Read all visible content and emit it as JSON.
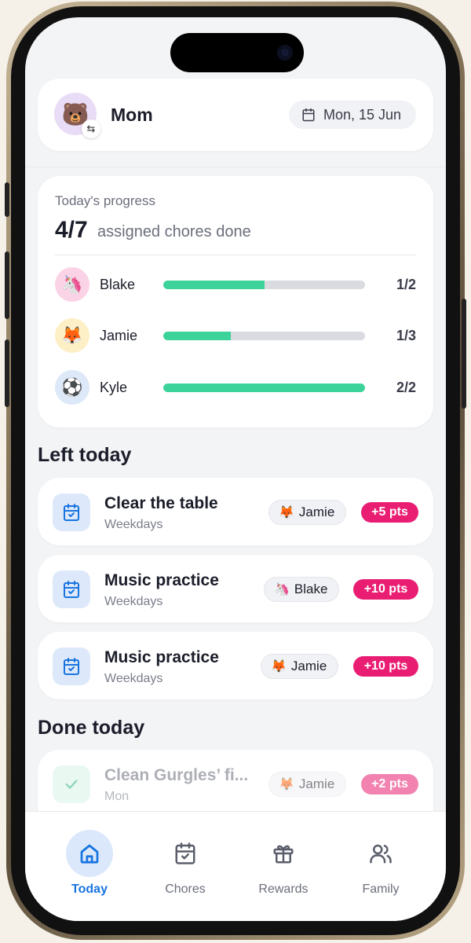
{
  "header": {
    "avatar_emoji": "🐻",
    "switch_glyph": "⇆",
    "name": "Mom",
    "date": "Mon, 15 Jun"
  },
  "progress": {
    "title": "Today's progress",
    "count": "4/7",
    "subtitle": "assigned chores done",
    "kids": [
      {
        "name": "Blake",
        "emoji": "🦄",
        "ratio": "1/2",
        "done": 1,
        "total": 2,
        "avatar_bg": "#fbd3e6"
      },
      {
        "name": "Jamie",
        "emoji": "🦊",
        "ratio": "1/3",
        "done": 1,
        "total": 3,
        "avatar_bg": "#fdf0c6"
      },
      {
        "name": "Kyle",
        "emoji": "⚽",
        "ratio": "2/2",
        "done": 2,
        "total": 2,
        "avatar_bg": "#dde8f8"
      }
    ]
  },
  "left_today": {
    "title": "Left today",
    "items": [
      {
        "name": "Clear the table",
        "freq": "Weekdays",
        "who": "Jamie",
        "who_emoji": "🦊",
        "points": "+5 pts"
      },
      {
        "name": "Music practice",
        "freq": "Weekdays",
        "who": "Blake",
        "who_emoji": "🦄",
        "points": "+10 pts"
      },
      {
        "name": "Music practice",
        "freq": "Weekdays",
        "who": "Jamie",
        "who_emoji": "🦊",
        "points": "+10 pts"
      }
    ]
  },
  "done_today": {
    "title": "Done today",
    "items": [
      {
        "name": "Clean Gurgles’ fi...",
        "freq": "Mon",
        "who": "Jamie",
        "who_emoji": "🦊",
        "points": "+2 pts"
      }
    ]
  },
  "nav": {
    "items": [
      {
        "label": "Today",
        "icon": "home-icon",
        "active": true
      },
      {
        "label": "Chores",
        "icon": "calendar-check-icon",
        "active": false
      },
      {
        "label": "Rewards",
        "icon": "gift-icon",
        "active": false
      },
      {
        "label": "Family",
        "icon": "users-icon",
        "active": false
      }
    ]
  },
  "colors": {
    "accent": "#1874e0",
    "progress": "#3cd39a",
    "points": "#e91e73"
  }
}
